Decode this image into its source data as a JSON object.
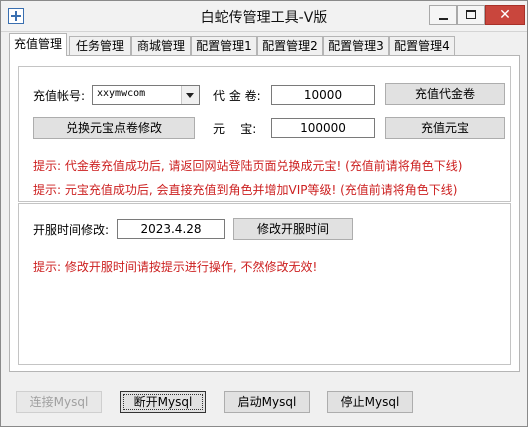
{
  "window": {
    "title": "白蛇传管理工具-V版"
  },
  "tabs": [
    {
      "label": "充值管理"
    },
    {
      "label": "任务管理"
    },
    {
      "label": "商城管理"
    },
    {
      "label": "配置管理1"
    },
    {
      "label": "配置管理2"
    },
    {
      "label": "配置管理3"
    },
    {
      "label": "配置管理4"
    }
  ],
  "recharge": {
    "account_label": "充值帐号:",
    "account_value": "xxymwcom",
    "voucher_label": "代 金 卷:",
    "voucher_value": "10000",
    "voucher_button": "充值代金卷",
    "exchange_button": "兑换元宝点卷修改",
    "yuanbao_label": "元    宝:",
    "yuanbao_value": "100000",
    "yuanbao_button": "充值元宝",
    "hint1": "提示: 代金卷充值成功后, 请返回网站登陆页面兑换成元宝! (充值前请将角色下线)",
    "hint2": "提示: 元宝充值成功后, 会直接充值到角色并增加VIP等级! (充值前请将角色下线)"
  },
  "open_time": {
    "label": "开服时间修改:",
    "value": "2023.4.28",
    "button": "修改开服时间",
    "hint": "提示: 修改开服时间请按提示进行操作, 不然修改无效!"
  },
  "footer": {
    "connect": "连接Mysql",
    "disconnect": "断开Mysql",
    "start": "启动Mysql",
    "stop": "停止Mysql"
  }
}
